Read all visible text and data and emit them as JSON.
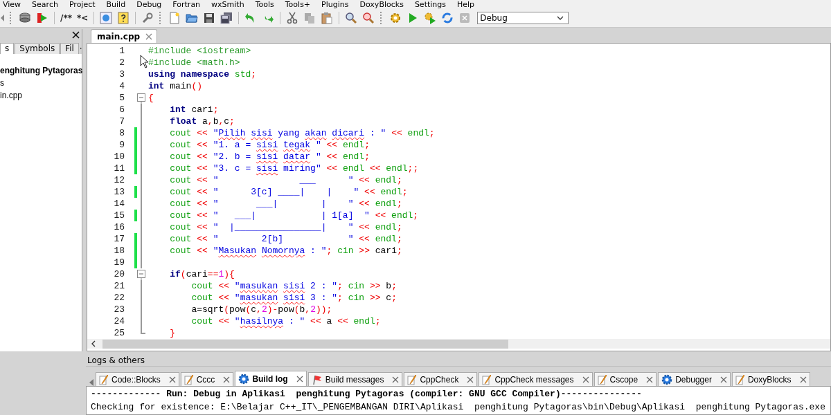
{
  "menu": [
    "View",
    "Search",
    "Project",
    "Build",
    "Debug",
    "Fortran",
    "wxSmith",
    "Tools",
    "Tools+",
    "Plugins",
    "DoxyBlocks",
    "Settings",
    "Help"
  ],
  "toolbar": {
    "texts": [
      "/**",
      "*<"
    ],
    "target": {
      "value": "Debug"
    }
  },
  "management": {
    "tabs": [
      {
        "label": "s",
        "selected": true
      },
      {
        "label": "Symbols",
        "selected": false
      },
      {
        "label": "Fil",
        "selected": false
      }
    ],
    "tree": [
      {
        "label": "enghitung Pytagoras",
        "bold": true
      },
      {
        "label": "s",
        "bold": false
      },
      {
        "label": "in.cpp",
        "bold": false
      }
    ]
  },
  "editor": {
    "tab": {
      "label": "main.cpp"
    },
    "lines": [
      {
        "number": "1",
        "changed": false,
        "kind": "plain",
        "tokens": [
          {
            "kind": "pp",
            "text": "#include <iostream>"
          }
        ]
      },
      {
        "number": "2",
        "changed": false,
        "kind": "plain",
        "tokens": [
          {
            "kind": "pp",
            "text": "#include <math.h>"
          }
        ]
      },
      {
        "number": "3",
        "changed": false,
        "kind": "plain",
        "tokens": [
          {
            "kind": "kw",
            "text": "using namespace "
          },
          {
            "kind": "lib",
            "text": "std"
          },
          {
            "kind": "op",
            "text": ";"
          }
        ]
      },
      {
        "number": "4",
        "changed": false,
        "kind": "plain",
        "tokens": [
          {
            "kind": "kw",
            "text": "int"
          },
          {
            "kind": "plain",
            "text": " main"
          },
          {
            "kind": "op",
            "text": "()"
          }
        ]
      },
      {
        "number": "5",
        "changed": false,
        "kind": "fold_start",
        "tokens": [
          {
            "kind": "op",
            "text": "{"
          }
        ]
      },
      {
        "number": "6",
        "changed": false,
        "kind": "fold_body",
        "tokens": [
          {
            "kind": "kw",
            "text": "    int"
          },
          {
            "kind": "plain",
            "text": " cari"
          },
          {
            "kind": "op",
            "text": ";"
          }
        ]
      },
      {
        "number": "7",
        "changed": false,
        "kind": "fold_body",
        "tokens": [
          {
            "kind": "kw",
            "text": "    float"
          },
          {
            "kind": "plain",
            "text": " a"
          },
          {
            "kind": "op",
            "text": ","
          },
          {
            "kind": "plain",
            "text": "b"
          },
          {
            "kind": "op",
            "text": ","
          },
          {
            "kind": "plain",
            "text": "c"
          },
          {
            "kind": "op",
            "text": ";"
          }
        ]
      },
      {
        "number": "8",
        "changed": true,
        "kind": "fold_body",
        "tokens": [
          {
            "kind": "lib",
            "text": "    cout"
          },
          {
            "kind": "op",
            "text": " << "
          },
          {
            "kind": "str",
            "text": "\""
          },
          {
            "kind": "spell",
            "text": "Pilih "
          },
          {
            "kind": "spell",
            "text": "sisi"
          },
          {
            "kind": "str",
            "text": " yang "
          },
          {
            "kind": "spell",
            "text": "akan "
          },
          {
            "kind": "spell",
            "text": "dicari"
          },
          {
            "kind": "str",
            "text": " : \""
          },
          {
            "kind": "op",
            "text": " << "
          },
          {
            "kind": "lib",
            "text": "endl"
          },
          {
            "kind": "op",
            "text": ";"
          }
        ]
      },
      {
        "number": "9",
        "changed": true,
        "kind": "fold_body",
        "tokens": [
          {
            "kind": "lib",
            "text": "    cout"
          },
          {
            "kind": "op",
            "text": " << "
          },
          {
            "kind": "str",
            "text": "\"1. a = "
          },
          {
            "kind": "spell",
            "text": "sisi "
          },
          {
            "kind": "spell",
            "text": "tegak"
          },
          {
            "kind": "str",
            "text": " \""
          },
          {
            "kind": "op",
            "text": " << "
          },
          {
            "kind": "lib",
            "text": "endl"
          },
          {
            "kind": "op",
            "text": ";"
          }
        ]
      },
      {
        "number": "10",
        "changed": true,
        "kind": "fold_body",
        "tokens": [
          {
            "kind": "lib",
            "text": "    cout"
          },
          {
            "kind": "op",
            "text": " << "
          },
          {
            "kind": "str",
            "text": "\"2. b = "
          },
          {
            "kind": "spell",
            "text": "sisi "
          },
          {
            "kind": "spell",
            "text": "datar"
          },
          {
            "kind": "str",
            "text": " \""
          },
          {
            "kind": "op",
            "text": " << "
          },
          {
            "kind": "lib",
            "text": "endl"
          },
          {
            "kind": "op",
            "text": ";"
          }
        ]
      },
      {
        "number": "11",
        "changed": true,
        "kind": "fold_body",
        "tokens": [
          {
            "kind": "lib",
            "text": "    cout"
          },
          {
            "kind": "op",
            "text": " << "
          },
          {
            "kind": "str",
            "text": "\"3. c = "
          },
          {
            "kind": "spell",
            "text": "sisi"
          },
          {
            "kind": "str",
            "text": " miring\""
          },
          {
            "kind": "op",
            "text": " << "
          },
          {
            "kind": "lib",
            "text": "endl"
          },
          {
            "kind": "op",
            "text": " << "
          },
          {
            "kind": "lib",
            "text": "endl"
          },
          {
            "kind": "op",
            "text": ";;"
          }
        ]
      },
      {
        "number": "12",
        "changed": false,
        "kind": "fold_body",
        "tokens": [
          {
            "kind": "lib",
            "text": "    cout"
          },
          {
            "kind": "op",
            "text": " << "
          },
          {
            "kind": "str",
            "text": "\"               ___      \""
          },
          {
            "kind": "op",
            "text": " << "
          },
          {
            "kind": "lib",
            "text": "endl"
          },
          {
            "kind": "op",
            "text": ";"
          }
        ]
      },
      {
        "number": "13",
        "changed": true,
        "kind": "fold_body",
        "tokens": [
          {
            "kind": "lib",
            "text": "    cout"
          },
          {
            "kind": "op",
            "text": " << "
          },
          {
            "kind": "str",
            "text": "\"      3[c] ____|    |    \""
          },
          {
            "kind": "op",
            "text": " << "
          },
          {
            "kind": "lib",
            "text": "endl"
          },
          {
            "kind": "op",
            "text": ";"
          }
        ]
      },
      {
        "number": "14",
        "changed": false,
        "kind": "fold_body",
        "tokens": [
          {
            "kind": "lib",
            "text": "    cout"
          },
          {
            "kind": "op",
            "text": " << "
          },
          {
            "kind": "str",
            "text": "\"       ___|        |    \""
          },
          {
            "kind": "op",
            "text": " << "
          },
          {
            "kind": "lib",
            "text": "endl"
          },
          {
            "kind": "op",
            "text": ";"
          }
        ]
      },
      {
        "number": "15",
        "changed": true,
        "kind": "fold_body",
        "tokens": [
          {
            "kind": "lib",
            "text": "    cout"
          },
          {
            "kind": "op",
            "text": " << "
          },
          {
            "kind": "str",
            "text": "\"   ___|            | 1[a]  \""
          },
          {
            "kind": "op",
            "text": " << "
          },
          {
            "kind": "lib",
            "text": "endl"
          },
          {
            "kind": "op",
            "text": ";"
          }
        ]
      },
      {
        "number": "16",
        "changed": false,
        "kind": "fold_body",
        "tokens": [
          {
            "kind": "lib",
            "text": "    cout"
          },
          {
            "kind": "op",
            "text": " << "
          },
          {
            "kind": "str",
            "text": "\"  |________________|    \""
          },
          {
            "kind": "op",
            "text": " << "
          },
          {
            "kind": "lib",
            "text": "endl"
          },
          {
            "kind": "op",
            "text": ";"
          }
        ]
      },
      {
        "number": "17",
        "changed": true,
        "kind": "fold_body",
        "tokens": [
          {
            "kind": "lib",
            "text": "    cout"
          },
          {
            "kind": "op",
            "text": " << "
          },
          {
            "kind": "str",
            "text": "\"        2[b]            \""
          },
          {
            "kind": "op",
            "text": " << "
          },
          {
            "kind": "lib",
            "text": "endl"
          },
          {
            "kind": "op",
            "text": ";"
          }
        ]
      },
      {
        "number": "18",
        "changed": true,
        "kind": "fold_body",
        "tokens": [
          {
            "kind": "lib",
            "text": "    cout"
          },
          {
            "kind": "op",
            "text": " << "
          },
          {
            "kind": "str",
            "text": "\""
          },
          {
            "kind": "spell",
            "text": "Masukan "
          },
          {
            "kind": "spell",
            "text": "Nomornya"
          },
          {
            "kind": "str",
            "text": " : \""
          },
          {
            "kind": "op",
            "text": "; "
          },
          {
            "kind": "lib",
            "text": "cin"
          },
          {
            "kind": "op",
            "text": " >> "
          },
          {
            "kind": "plain",
            "text": "cari"
          },
          {
            "kind": "op",
            "text": ";"
          }
        ]
      },
      {
        "number": "19",
        "changed": true,
        "kind": "fold_body"
      },
      {
        "number": "20",
        "changed": false,
        "kind": "fold_start",
        "tokens": [
          {
            "kind": "kw",
            "text": "    if"
          },
          {
            "kind": "op",
            "text": "("
          },
          {
            "kind": "plain",
            "text": "cari"
          },
          {
            "kind": "op",
            "text": "=="
          },
          {
            "kind": "num",
            "text": "1"
          },
          {
            "kind": "op",
            "text": "){"
          }
        ]
      },
      {
        "number": "21",
        "changed": false,
        "kind": "fold_body",
        "tokens": [
          {
            "kind": "lib",
            "text": "        cout"
          },
          {
            "kind": "op",
            "text": " << "
          },
          {
            "kind": "str",
            "text": "\""
          },
          {
            "kind": "spell",
            "text": "masukan "
          },
          {
            "kind": "spell",
            "text": "sisi"
          },
          {
            "kind": "str",
            "text": " 2 : \""
          },
          {
            "kind": "op",
            "text": "; "
          },
          {
            "kind": "lib",
            "text": "cin"
          },
          {
            "kind": "op",
            "text": " >> "
          },
          {
            "kind": "plain",
            "text": "b"
          },
          {
            "kind": "op",
            "text": ";"
          }
        ]
      },
      {
        "number": "22",
        "changed": false,
        "kind": "fold_body",
        "tokens": [
          {
            "kind": "lib",
            "text": "        cout"
          },
          {
            "kind": "op",
            "text": " << "
          },
          {
            "kind": "str",
            "text": "\""
          },
          {
            "kind": "spell",
            "text": "masukan "
          },
          {
            "kind": "spell",
            "text": "sisi"
          },
          {
            "kind": "str",
            "text": " 3 : \""
          },
          {
            "kind": "op",
            "text": "; "
          },
          {
            "kind": "lib",
            "text": "cin"
          },
          {
            "kind": "op",
            "text": " >> "
          },
          {
            "kind": "plain",
            "text": "c"
          },
          {
            "kind": "op",
            "text": ";"
          }
        ]
      },
      {
        "number": "23",
        "changed": false,
        "kind": "fold_body",
        "tokens": [
          {
            "kind": "plain",
            "text": "        a=sqrt"
          },
          {
            "kind": "op",
            "text": "("
          },
          {
            "kind": "plain",
            "text": "pow"
          },
          {
            "kind": "op",
            "text": "("
          },
          {
            "kind": "plain",
            "text": "c"
          },
          {
            "kind": "op",
            "text": ","
          },
          {
            "kind": "num",
            "text": "2"
          },
          {
            "kind": "op",
            "text": ")-"
          },
          {
            "kind": "plain",
            "text": "pow"
          },
          {
            "kind": "op",
            "text": "("
          },
          {
            "kind": "plain",
            "text": "b"
          },
          {
            "kind": "op",
            "text": ","
          },
          {
            "kind": "num",
            "text": "2"
          },
          {
            "kind": "op",
            "text": "));"
          }
        ]
      },
      {
        "number": "24",
        "changed": false,
        "kind": "fold_body",
        "tokens": [
          {
            "kind": "lib",
            "text": "        cout"
          },
          {
            "kind": "op",
            "text": " << "
          },
          {
            "kind": "str",
            "text": "\""
          },
          {
            "kind": "spell",
            "text": "hasilnya"
          },
          {
            "kind": "str",
            "text": " : \""
          },
          {
            "kind": "op",
            "text": " << "
          },
          {
            "kind": "plain",
            "text": "a"
          },
          {
            "kind": "op",
            "text": " << "
          },
          {
            "kind": "lib",
            "text": "endl"
          },
          {
            "kind": "op",
            "text": ";"
          }
        ]
      },
      {
        "number": "25",
        "changed": false,
        "kind": "fold_end",
        "tokens": [
          {
            "kind": "op",
            "text": "    }"
          }
        ]
      }
    ]
  },
  "logs": {
    "title": "Logs & others",
    "tabs": [
      {
        "label": "Code::Blocks",
        "kind": "pencil",
        "selected": false
      },
      {
        "label": "Cccc",
        "kind": "pencil",
        "selected": false
      },
      {
        "label": "Build log",
        "kind": "gear",
        "selected": true
      },
      {
        "label": "Build messages",
        "kind": "flag",
        "selected": false
      },
      {
        "label": "CppCheck",
        "kind": "pencil",
        "selected": false
      },
      {
        "label": "CppCheck messages",
        "kind": "pencil",
        "selected": false
      },
      {
        "label": "Cscope",
        "kind": "pencil",
        "selected": false
      },
      {
        "label": "Debugger",
        "kind": "gear",
        "selected": false
      },
      {
        "label": "DoxyBlocks",
        "kind": "pencil",
        "selected": false
      }
    ],
    "lines": [
      {
        "text": "------------- Run: Debug in Aplikasi  penghitung Pytagoras (compiler: GNU GCC Compiler)---------------",
        "bold": true
      },
      {
        "text": "Checking for existence: E:\\Belajar C++_IT\\_PENGEMBANGAN DIRI\\Aplikasi  penghitung Pytagoras\\bin\\Debug\\Aplikasi  penghitung Pytagoras.exe",
        "bold": false
      }
    ]
  }
}
